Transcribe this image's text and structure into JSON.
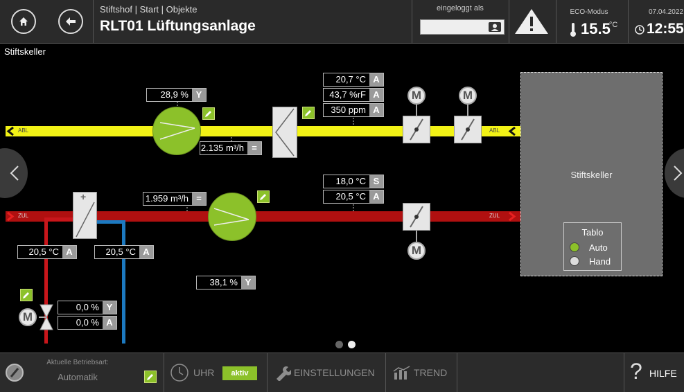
{
  "header": {
    "breadcrumb": "Stiftshof | Start | Objekte",
    "title": "RLT01 Lüftungsanlage",
    "login_label": "eingeloggt als",
    "eco_label": "ECO-Modus",
    "eco_temp": "15.5",
    "eco_unit": "°C",
    "date": "07.04.2022",
    "time": "12:55"
  },
  "page": {
    "section_label": "Stiftskeller"
  },
  "exhaust": {
    "duct_label_left": "ABL",
    "duct_label_right": "ABL",
    "fan_value": "28,9 %",
    "fan_mode": "Y",
    "flow_value": "2.135 m³/h",
    "flow_mode": "=",
    "temp_value": "20,7 °C",
    "temp_mode": "A",
    "humidity_value": "43,7 %rF",
    "humidity_mode": "A",
    "co2_value": "350 ppm",
    "co2_mode": "A",
    "motor_label_1": "M",
    "motor_label_2": "M"
  },
  "supply": {
    "duct_label_left": "ZUL",
    "duct_label_right": "ZUL",
    "flow_value": "1.959 m³/h",
    "flow_mode": "=",
    "setpoint_value": "18,0 °C",
    "setpoint_mode": "S",
    "temp_value": "20,5 °C",
    "temp_mode": "A",
    "fan_value": "38,1 %",
    "fan_mode": "Y",
    "motor_label": "M"
  },
  "heater": {
    "flow_temp_value": "20,5 °C",
    "flow_temp_mode": "A",
    "return_temp_value": "20,5 °C",
    "return_temp_mode": "A",
    "valve_value": "0,0 %",
    "valve_mode": "Y",
    "valve_feedback": "0,0 %",
    "valve_feedback_mode": "A",
    "motor_label": "M"
  },
  "room": {
    "name": "Stiftskeller",
    "tablo_title": "Tablo",
    "option_auto": "Auto",
    "option_hand": "Hand"
  },
  "footer": {
    "mode_label": "Aktuelle Betriebsart:",
    "mode_value": "Automatik",
    "clock_label": "UHR",
    "clock_status": "aktiv",
    "settings_label": "EINSTELLUNGEN",
    "trend_label": "TREND",
    "help_label": "HILFE"
  },
  "colors": {
    "exhaust_duct": "#f2f216",
    "supply_duct": "#b01010",
    "fan": "#8cc12a",
    "room": "#6e6e6e",
    "hot_pipe": "#c8161b",
    "cold_pipe": "#1c79c0"
  }
}
